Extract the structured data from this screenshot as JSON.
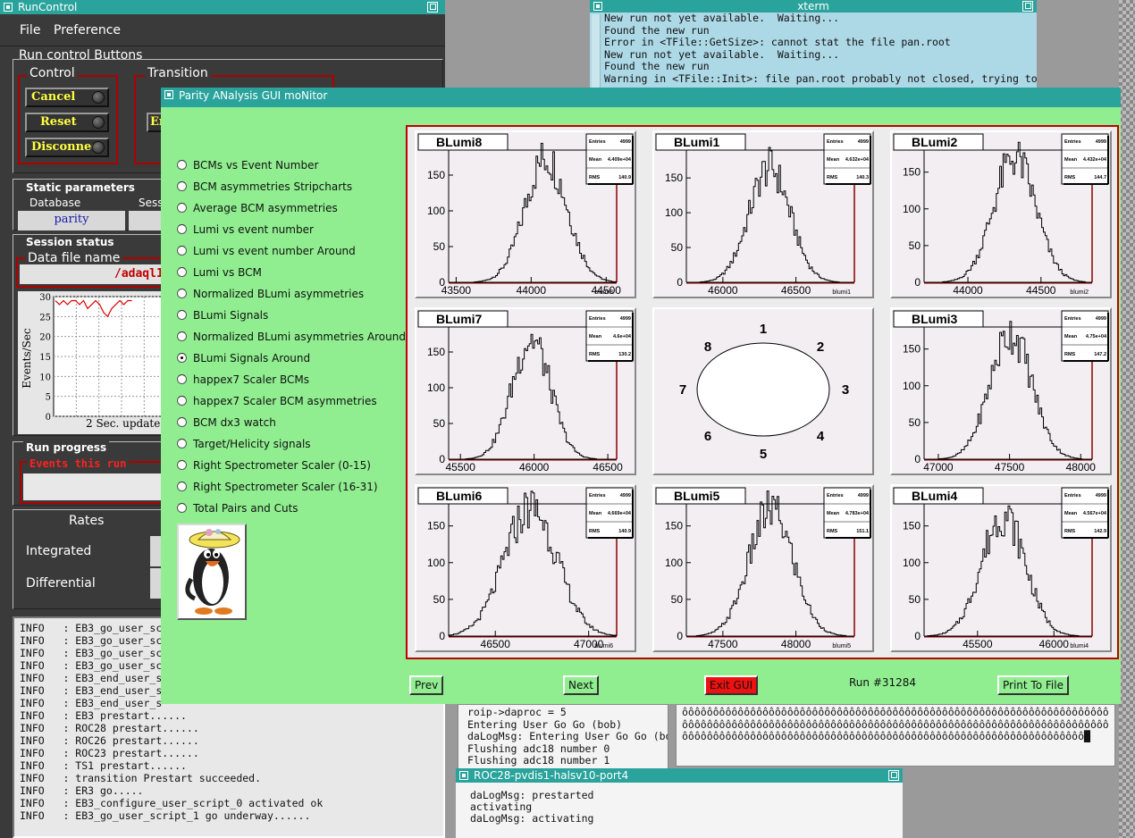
{
  "runcontrol": {
    "title": "RunControl",
    "menu": [
      "File",
      "Preference"
    ],
    "run_control_buttons_label": "Run control Buttons",
    "control_label": "Control",
    "transition_label": "Transition",
    "buttons": {
      "cancel": "Cancel",
      "reset": "Reset",
      "disconnect": "Disconnect"
    },
    "transition_partial": "En",
    "static_parameters_label": "Static parameters",
    "database_label": "Database",
    "database_value": "parity",
    "session_partial": "Sess",
    "session_status_label": "Session status",
    "data_file_label": "Data file name",
    "data_file_value": "/adaql1",
    "rate_ylabel": "Events/Sec",
    "rate_yticks": [
      "30",
      "25",
      "20",
      "15",
      "10",
      "5",
      "0"
    ],
    "update_label": "2 Sec. update",
    "run_progress_label": "Run progress",
    "events_this_run_label": "Events this run",
    "rates_label": "Rates",
    "integrated_label": "Integrated",
    "differential_label": "Differential",
    "log": [
      "INFO   : EB3_go_user_sc",
      "INFO   : EB3_go_user_sc",
      "INFO   : EB3_go_user_sc",
      "INFO   : EB3_go_user_sc",
      "INFO   : EB3_end_user_s",
      "INFO   : EB3_end_user_s",
      "INFO   : EB3_end_user_s",
      "INFO   : EB3 prestart......",
      "INFO   : ROC28 prestart......",
      "INFO   : ROC26 prestart......",
      "INFO   : ROC23 prestart......",
      "INFO   : TS1 prestart......",
      "INFO   : transition Prestart succeeded.",
      "INFO   : ER3 go.....",
      "INFO   : EB3_configure_user_script_0 activated ok",
      "INFO   : EB3_go_user_script_1 go underway......"
    ]
  },
  "xterm": {
    "title": "xterm",
    "lines": [
      "New run not yet available.  Waiting...",
      "Found the new run",
      "Error in <TFile::GetSize>: cannot stat the file pan.root",
      "New run not yet available.  Waiting...",
      "Found the new run",
      "Warning in <TFile::Init>: file pan.root probably not closed, trying to recover"
    ]
  },
  "term_mid": {
    "lines": [
      "roip->daproc = 5",
      "Entering User Go Go (bob)",
      "daLogMsg: Entering User Go Go (bob)",
      "Flushing adc18 number 0",
      "Flushing adc18 number 1"
    ]
  },
  "term_right": {
    "text": "ôôôôôôôôôôôôôôôôôôôôôôôôôôôôôôôôôôôôôôôôôôôôôôôôôôôôôôôôôôôôôôôôôôôôôôôôôôôôôôôôôôôôôôôôôôôôôôôôôôôôôôôôôôôôôôôôôôôôôôôôôôôôôôôôôôôôôôôôôôôôôôôôôôôôôôôôôôôôôôôôôôôôôôôôôôôôôôôôôôôôôôôôôôôôôôôôôôôôôôôôôôô█"
  },
  "roc28": {
    "title": "ROC28-pvdis1-halsv10-port4",
    "lines": [
      "daLogMsg: prestarted",
      "activating",
      "daLogMsg: activating"
    ]
  },
  "pan": {
    "title": "Parity ANalysis GUI moNitor",
    "options": [
      {
        "label": "BCMs vs Event Number",
        "selected": false
      },
      {
        "label": "BCM asymmetries Stripcharts",
        "selected": false
      },
      {
        "label": "Average BCM asymmetries",
        "selected": false
      },
      {
        "label": "Lumi vs event number",
        "selected": false
      },
      {
        "label": "Lumi vs event number Around",
        "selected": false
      },
      {
        "label": "Lumi vs BCM",
        "selected": false
      },
      {
        "label": "Normalized BLumi asymmetries",
        "selected": false
      },
      {
        "label": "BLumi Signals",
        "selected": false
      },
      {
        "label": "Normalized BLumi asymmetries Around",
        "selected": false
      },
      {
        "label": "BLumi Signals Around",
        "selected": true
      },
      {
        "label": "happex7 Scaler BCMs",
        "selected": false
      },
      {
        "label": "happex7 Scaler BCM asymmetries",
        "selected": false
      },
      {
        "label": "BCM dx3 watch",
        "selected": false
      },
      {
        "label": "Target/Helicity signals",
        "selected": false
      },
      {
        "label": "Right Spectrometer Scaler (0-15)",
        "selected": false
      },
      {
        "label": "Right Spectrometer Scaler (16-31)",
        "selected": false
      },
      {
        "label": "Total Pairs and Cuts",
        "selected": false
      }
    ],
    "buttons": {
      "prev": "Prev",
      "next": "Next",
      "exit": "Exit GUI",
      "print": "Print To File"
    },
    "run_number": "Run #31284",
    "map_labels": [
      "1",
      "2",
      "3",
      "4",
      "5",
      "6",
      "7",
      "8"
    ]
  },
  "chart_data": [
    {
      "type": "bar",
      "title": "BLumi8",
      "xlabel": "blumi8",
      "xticks": [
        43500,
        44000,
        44500
      ],
      "xlim": [
        43450,
        44570
      ],
      "yticks": [
        0,
        50,
        100,
        150
      ],
      "ylim": [
        0,
        185
      ],
      "mean": 44100,
      "rms": 140,
      "peak": 175,
      "stats": {
        "Entries": "4999",
        "Mean": "4.409e+04",
        "RMS": "140.9"
      }
    },
    {
      "type": "bar",
      "title": "BLumi1",
      "xlabel": "blumi1",
      "xticks": [
        46000,
        46500
      ],
      "xlim": [
        45750,
        46900
      ],
      "yticks": [
        0,
        50,
        100,
        150
      ],
      "ylim": [
        0,
        190
      ],
      "mean": 46320,
      "rms": 140,
      "peak": 165,
      "stats": {
        "Entries": "4999",
        "Mean": "4.632e+04",
        "RMS": "140.3"
      }
    },
    {
      "type": "bar",
      "title": "BLumi2",
      "xlabel": "blumi2",
      "xticks": [
        44000,
        44500
      ],
      "xlim": [
        43700,
        44850
      ],
      "yticks": [
        0,
        50,
        100,
        150
      ],
      "ylim": [
        0,
        180
      ],
      "mean": 44320,
      "rms": 145,
      "peak": 170,
      "stats": {
        "Entries": "4999",
        "Mean": "4.432e+04",
        "RMS": "144.7"
      }
    },
    {
      "type": "bar",
      "title": "BLumi7",
      "xlabel": "",
      "xticks": [
        45500,
        46000,
        46500
      ],
      "xlim": [
        45420,
        46560
      ],
      "yticks": [
        0,
        50,
        100,
        150
      ],
      "ylim": [
        0,
        185
      ],
      "mean": 45980,
      "rms": 130,
      "peak": 168,
      "stats": {
        "Entries": "4999",
        "Mean": "4.6e+04",
        "RMS": "130.2"
      }
    },
    {
      "type": "bar",
      "title": "BLumi3",
      "xlabel": "",
      "xticks": [
        47000,
        47500,
        48000
      ],
      "xlim": [
        46900,
        48080
      ],
      "yticks": [
        0,
        50,
        100,
        150
      ],
      "ylim": [
        0,
        180
      ],
      "mean": 47510,
      "rms": 147,
      "peak": 172,
      "stats": {
        "Entries": "4999",
        "Mean": "4.75e+04",
        "RMS": "147.2"
      }
    },
    {
      "type": "bar",
      "title": "BLumi6",
      "xlabel": "blumi6",
      "xticks": [
        46500,
        47000
      ],
      "xlim": [
        46250,
        47150
      ],
      "yticks": [
        0,
        50,
        100,
        150
      ],
      "ylim": [
        0,
        180
      ],
      "mean": 46690,
      "rms": 141,
      "peak": 175,
      "stats": {
        "Entries": "4999",
        "Mean": "4.669e+04",
        "RMS": "140.9"
      }
    },
    {
      "type": "bar",
      "title": "BLumi5",
      "xlabel": "blumi5",
      "xticks": [
        47500,
        48000
      ],
      "xlim": [
        47250,
        48400
      ],
      "yticks": [
        0,
        50,
        100,
        150
      ],
      "ylim": [
        0,
        180
      ],
      "mean": 47830,
      "rms": 151,
      "peak": 172,
      "stats": {
        "Entries": "4999",
        "Mean": "4.783e+04",
        "RMS": "151.1"
      }
    },
    {
      "type": "bar",
      "title": "BLumi4",
      "xlabel": "blumi4",
      "xticks": [
        45500,
        46000
      ],
      "xlim": [
        45150,
        46250
      ],
      "yticks": [
        0,
        50,
        100,
        150
      ],
      "ylim": [
        0,
        180
      ],
      "mean": 45670,
      "rms": 143,
      "peak": 165,
      "stats": {
        "Entries": "4999",
        "Mean": "4.567e+04",
        "RMS": "142.9"
      }
    }
  ]
}
